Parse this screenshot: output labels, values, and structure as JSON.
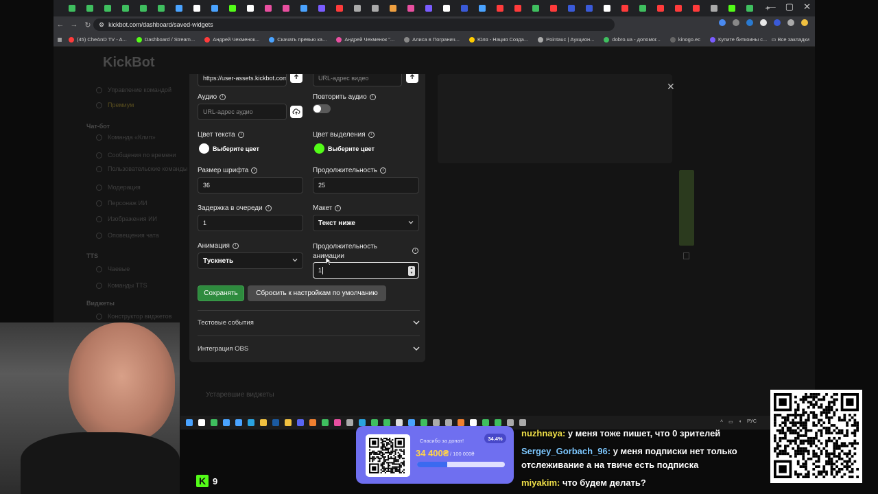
{
  "browser": {
    "url": "kickbot.com/dashboard/saved-widgets",
    "window_controls": [
      "—",
      "▢",
      "✕"
    ],
    "bookmarks": [
      {
        "label": "(45) ChеAnD TV - A...",
        "color": "#ff3b3b"
      },
      {
        "label": "Dashboard / Stream...",
        "color": "#53fc18"
      },
      {
        "label": "Андрей Чехменок...",
        "color": "#ff3b3b"
      },
      {
        "label": "Скачать превью ка...",
        "color": "#4aa3ff"
      },
      {
        "label": "Андрей Чехменок \"...",
        "color": "#e94fa0"
      },
      {
        "label": "Алиса в Погранич...",
        "color": "#888888"
      },
      {
        "label": "Юля - Нация Созда...",
        "color": "#ffcc00"
      },
      {
        "label": "Pointauc | Аукцион...",
        "color": "#aaaaaa"
      },
      {
        "label": "dobro.ua - допомог...",
        "color": "#3fbf5f"
      },
      {
        "label": "kinogo.ec",
        "color": "#666666"
      },
      {
        "label": "Купите биткоины с...",
        "color": "#7a5cff"
      }
    ],
    "all_bookmarks": "Все закладки"
  },
  "page": {
    "logo": "KickBot",
    "sidebar": [
      {
        "label": "Управление командой",
        "kind": "item"
      },
      {
        "label": "Премиум",
        "kind": "gold"
      },
      {
        "label": "Чат-бот",
        "kind": "heading"
      },
      {
        "label": "Команда «Клип»",
        "kind": "item"
      },
      {
        "label": "Сообщения по времени",
        "kind": "item"
      },
      {
        "label": "Пользовательские команды",
        "kind": "item"
      },
      {
        "label": "Модерация",
        "kind": "item"
      },
      {
        "label": "Персонаж ИИ",
        "kind": "item"
      },
      {
        "label": "Изображения ИИ",
        "kind": "item"
      },
      {
        "label": "Оповещения чата",
        "kind": "item"
      },
      {
        "label": "TTS",
        "kind": "heading"
      },
      {
        "label": "Чаевые",
        "kind": "item"
      },
      {
        "label": "Команды TTS",
        "kind": "item"
      },
      {
        "label": "Виджеты",
        "kind": "heading"
      },
      {
        "label": "Конструктор виджетов",
        "kind": "item"
      }
    ],
    "outdated_widgets": "Устаревшие виджеты",
    "close_symbol": "✕"
  },
  "form": {
    "image_url_value": "https://user-assets.kickbot.com/",
    "video_url_placeholder": "URL-адрес видео",
    "audio": {
      "label": "Аудио",
      "placeholder": "URL-адрес аудио"
    },
    "repeat_audio": {
      "label": "Повторить аудио",
      "enabled": false
    },
    "text_color": {
      "label": "Цвет текста",
      "button": "Выберите цвет",
      "color": "#ffffff"
    },
    "highlight_color": {
      "label": "Цвет выделения",
      "button": "Выберите цвет",
      "color": "#53fc18"
    },
    "font_size": {
      "label": "Размер шрифта",
      "value": "36"
    },
    "duration": {
      "label": "Продолжительность",
      "value": "25"
    },
    "queue_delay": {
      "label": "Задержка в очереди",
      "value": "1"
    },
    "layout": {
      "label": "Макет",
      "value": "Текст ниже"
    },
    "animation": {
      "label": "Анимация",
      "value": "Тускнеть"
    },
    "animation_duration": {
      "label": "Продолжительность анимации",
      "value": "1"
    },
    "save_button": "Сохранять",
    "reset_button": "Сбросить к настройкам по умолчанию",
    "accordion": [
      "Тестовые события",
      "Интеграция OBS"
    ]
  },
  "stream": {
    "kick_viewers": "9",
    "donation": {
      "title": "Спасибо за донат!",
      "percent_label": "34.4%",
      "percent": 34.4,
      "amount": "34 400₴",
      "goal": "/ 100 000₴"
    },
    "chat": [
      {
        "user": "nuzhnaya:",
        "text": "у меня тоже пишет, что 0 зрителей",
        "blue": false
      },
      {
        "user": "Sergey_Gorbach_96:",
        "text": "у меня подписки нет только",
        "blue": true
      },
      {
        "user": "",
        "text": "отслеживание а на твиче есть подписка",
        "blue": false
      },
      {
        "user": "miyakim:",
        "text": "что будем делать?",
        "blue": false
      }
    ],
    "tray": [
      "РУС"
    ]
  },
  "colors": {
    "kick_green": "#53fc18",
    "save_green": "#2e8b3e",
    "donation_purple": "#6f6ff0"
  }
}
